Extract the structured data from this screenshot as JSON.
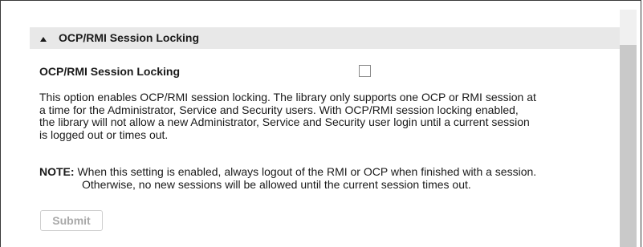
{
  "panel": {
    "title": "OCP/RMI Session Locking",
    "collapse_icon": "triangle-up-icon"
  },
  "setting": {
    "label": "OCP/RMI Session Locking",
    "checked": false
  },
  "description": {
    "lines": [
      "This option enables OCP/RMI session locking. The library only supports one OCP or RMI session at",
      "a time for the Administrator, Service and Security users. With OCP/RMI session locking enabled,",
      "the library will not allow a new Administrator, Service and Security user login until a current session",
      "is logged out or times out."
    ]
  },
  "note": {
    "label": "NOTE:",
    "line1": " When this setting is enabled, always logout of the RMI or OCP when finished with a session.",
    "line2": "Otherwise, no new sessions will be allowed until the current session times out."
  },
  "actions": {
    "submit_label": "Submit",
    "submit_disabled": true
  },
  "colors": {
    "header_bg": "#e8e8e8",
    "text": "#1a1a1a",
    "disabled_text": "#a9a9a9",
    "scrollbar_thumb": "#c9c9c9"
  }
}
